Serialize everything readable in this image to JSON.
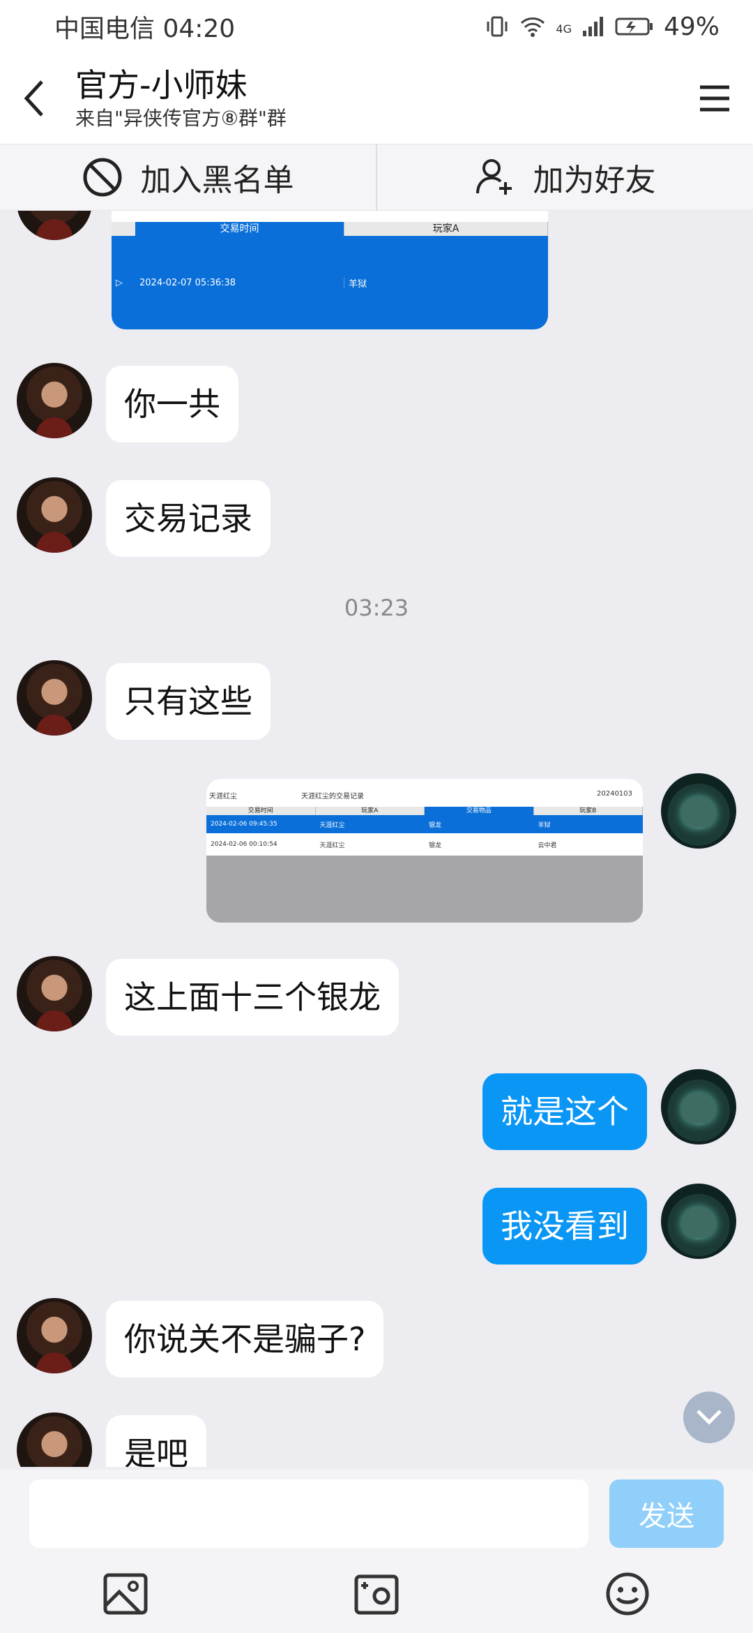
{
  "status_bar": {
    "carrier_time": "中国电信 04:20",
    "network": "4G",
    "battery": "49%"
  },
  "header": {
    "title": "官方-小师妹",
    "subtitle": "来自\"异侠传官方⑧群\"群"
  },
  "actions": {
    "blacklist": "加入黑名单",
    "add_friend": "加为好友"
  },
  "images": {
    "first": {
      "columns": [
        "交易时间",
        "玩家A"
      ],
      "row": [
        "2024-02-07 05:36:38",
        "羊狱"
      ]
    },
    "second": {
      "top_left": "天涯红尘",
      "top_middle": "天涯红尘的交易记录",
      "top_right": "20240103",
      "columns": [
        "交易时间",
        "玩家A",
        "交易物品",
        "玩家B"
      ],
      "rows": [
        [
          "2024-02-06 09:45:35",
          "天涯红尘",
          "银龙",
          "羊狱"
        ],
        [
          "2024-02-06 00:10:54",
          "天涯红尘",
          "银龙",
          "云中君"
        ]
      ]
    }
  },
  "messages": [
    {
      "side": "left",
      "text": "你一共"
    },
    {
      "side": "left",
      "text": "交易记录"
    },
    {
      "type": "time",
      "text": "03:23"
    },
    {
      "side": "left",
      "text": "只有这些"
    },
    {
      "side": "left",
      "text": "这上面十三个银龙"
    },
    {
      "side": "right",
      "text": "就是这个"
    },
    {
      "side": "right",
      "text": "我没看到"
    },
    {
      "side": "left",
      "text": "你说关不是骗子?"
    },
    {
      "side": "left",
      "text": "是吧"
    }
  ],
  "input": {
    "value": "",
    "send_label": "发送"
  },
  "colors": {
    "accent": "#0a96f5",
    "send_disabled": "#8fcff9",
    "background": "#ececf1"
  }
}
